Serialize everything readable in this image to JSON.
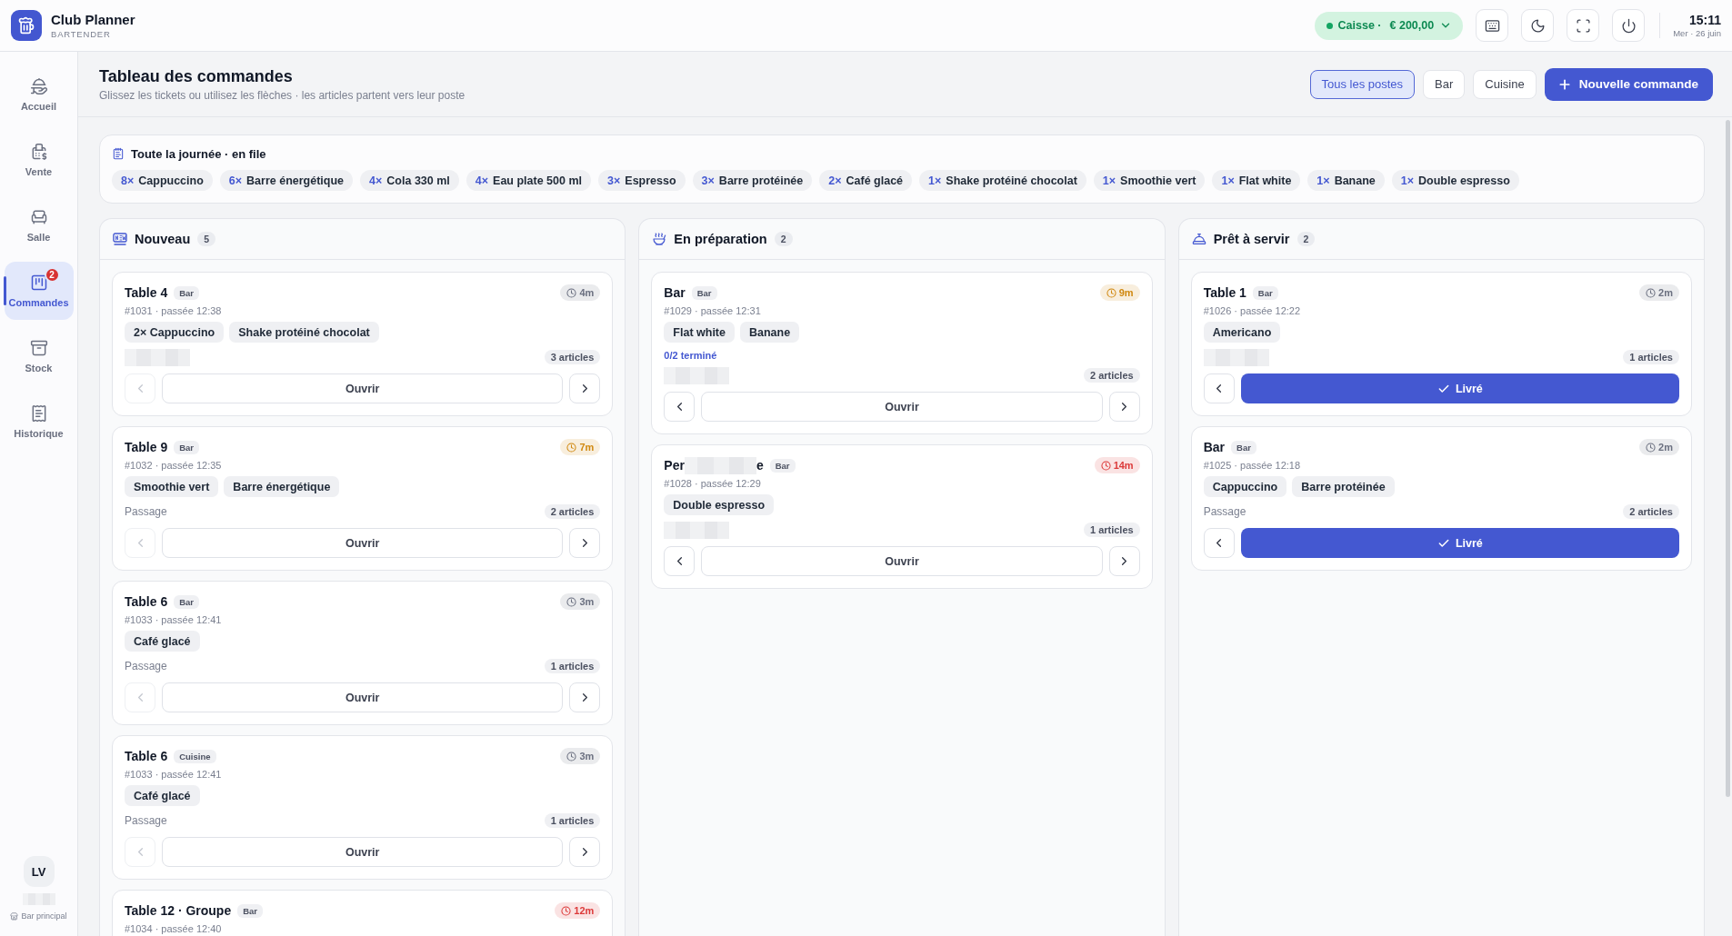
{
  "app": {
    "name": "Club Planner",
    "role": "BARTENDER"
  },
  "register": {
    "label": "Caisse ·",
    "amount": "€ 200,00",
    "open": true
  },
  "clock": {
    "time": "15:11",
    "date": "Mer · 26 juin"
  },
  "sidebar": {
    "items": [
      {
        "label": "Accueil",
        "selected": false
      },
      {
        "label": "Vente",
        "selected": false
      },
      {
        "label": "Salle",
        "selected": false
      },
      {
        "label": "Commandes",
        "selected": true,
        "badge": "2"
      },
      {
        "label": "Stock",
        "selected": false
      },
      {
        "label": "Historique",
        "selected": false
      }
    ],
    "user": {
      "initials": "LV",
      "name_hidden": true,
      "station": "Bar principal"
    }
  },
  "page": {
    "title": "Tableau des commandes",
    "subtitle": "Glissez les tickets ou utilisez les flèches · les articles partent vers leur poste"
  },
  "station_filter": [
    {
      "label": "Tous les postes",
      "selected": true
    },
    {
      "label": "Bar",
      "selected": false
    },
    {
      "label": "Cuisine",
      "selected": false
    }
  ],
  "new_order_button": "Nouvelle commande",
  "queue": {
    "title": "Toute la journée · en file",
    "items": [
      {
        "qty": "8×",
        "name": "Cappuccino"
      },
      {
        "qty": "6×",
        "name": "Barre énergétique"
      },
      {
        "qty": "4×",
        "name": "Cola 330 ml"
      },
      {
        "qty": "4×",
        "name": "Eau plate 500 ml"
      },
      {
        "qty": "3×",
        "name": "Espresso"
      },
      {
        "qty": "3×",
        "name": "Barre protéinée"
      },
      {
        "qty": "2×",
        "name": "Café glacé"
      },
      {
        "qty": "1×",
        "name": "Shake protéiné chocolat"
      },
      {
        "qty": "1×",
        "name": "Smoothie vert"
      },
      {
        "qty": "1×",
        "name": "Flat white"
      },
      {
        "qty": "1×",
        "name": "Banane"
      },
      {
        "qty": "1×",
        "name": "Double espresso"
      }
    ]
  },
  "columns": [
    {
      "title": "Nouveau",
      "count": "5",
      "cards": [
        {
          "title": "Table 4",
          "station": "Bar",
          "timer": {
            "elapsed": "4m",
            "color": "#6b7080"
          },
          "meta": "#1031 · passée 12:38",
          "items": [
            "2× Cappuccino",
            "Shake protéiné chocolat"
          ],
          "note": {
            "kind": "hidden"
          },
          "articles": "3 articles",
          "back_enabled": false,
          "action": {
            "kind": "open",
            "label": "Ouvrir"
          }
        },
        {
          "title": "Table 9",
          "station": "Bar",
          "timer": {
            "elapsed": "7m",
            "color": "#d08810"
          },
          "meta": "#1032 · passée 12:35",
          "items": [
            "Smoothie vert",
            "Barre énergétique"
          ],
          "note": {
            "kind": "text",
            "text": "Passage"
          },
          "articles": "2 articles",
          "back_enabled": false,
          "action": {
            "kind": "open",
            "label": "Ouvrir"
          }
        },
        {
          "title": "Table 6",
          "station": "Bar",
          "timer": {
            "elapsed": "3m",
            "color": "#6b7080"
          },
          "meta": "#1033 · passée 12:41",
          "items": [
            "Café glacé"
          ],
          "note": {
            "kind": "text",
            "text": "Passage"
          },
          "articles": "1 articles",
          "back_enabled": false,
          "action": {
            "kind": "open",
            "label": "Ouvrir"
          }
        },
        {
          "title": "Table 6",
          "station": "Cuisine",
          "timer": {
            "elapsed": "3m",
            "color": "#6b7080"
          },
          "meta": "#1033 · passée 12:41",
          "items": [
            "Café glacé"
          ],
          "note": {
            "kind": "text",
            "text": "Passage"
          },
          "articles": "1 articles",
          "back_enabled": false,
          "action": {
            "kind": "open",
            "label": "Ouvrir"
          }
        },
        {
          "title": "Table 12 · Groupe",
          "station": "Bar",
          "timer": {
            "elapsed": "12m",
            "color": "#dc3a3a"
          },
          "meta": "#1034 · passée 12:40"
        }
      ]
    },
    {
      "title": "En préparation",
      "count": "2",
      "cards": [
        {
          "title": "Bar",
          "station": "Bar",
          "timer": {
            "elapsed": "9m",
            "color": "#d08810"
          },
          "meta": "#1029 · passée 12:31",
          "items": [
            "Flat white",
            "Banane"
          ],
          "progress": "0/2 terminé",
          "note": {
            "kind": "hidden"
          },
          "articles": "2 articles",
          "back_enabled": true,
          "action": {
            "kind": "open",
            "label": "Ouvrir"
          }
        },
        {
          "title": "Per",
          "title_hidden": true,
          "title_end": "e",
          "station": "Bar",
          "timer": {
            "elapsed": "14m",
            "color": "#dc3a3a"
          },
          "meta": "#1028 · passée 12:29",
          "items": [
            "Double espresso"
          ],
          "note": {
            "kind": "hidden"
          },
          "articles": "1 articles",
          "back_enabled": true,
          "action": {
            "kind": "open",
            "label": "Ouvrir"
          }
        }
      ]
    },
    {
      "title": "Prêt à servir",
      "count": "2",
      "cards": [
        {
          "title": "Table 1",
          "station": "Bar",
          "timer": {
            "elapsed": "2m",
            "color": "#6b7080"
          },
          "meta": "#1026 · passée 12:22",
          "items": [
            "Americano"
          ],
          "note": {
            "kind": "hidden"
          },
          "articles": "1 articles",
          "back_enabled": true,
          "action": {
            "kind": "deliver",
            "label": "Livré"
          }
        },
        {
          "title": "Bar",
          "station": "Bar",
          "timer": {
            "elapsed": "2m",
            "color": "#6b7080"
          },
          "meta": "#1025 · passée 12:18",
          "items": [
            "Cappuccino",
            "Barre protéinée"
          ],
          "note": {
            "kind": "text",
            "text": "Passage"
          },
          "articles": "2 articles",
          "back_enabled": true,
          "action": {
            "kind": "deliver",
            "label": "Livré"
          }
        }
      ]
    }
  ]
}
